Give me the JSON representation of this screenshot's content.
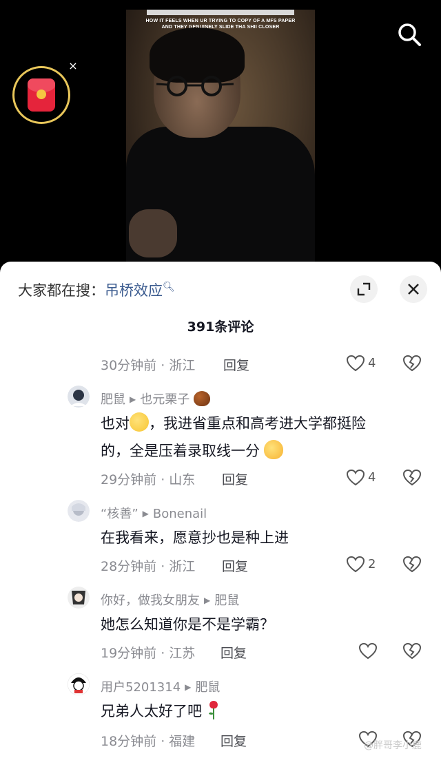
{
  "video": {
    "caption_top": "",
    "caption_line1": "HOW IT FEELS WHEN UR TRYING TO COPY OF A MFS PAPER",
    "caption_line2": "AND THEY GENUINELY SLIDE THA SHII CLOSER"
  },
  "icons": {
    "search": "search-icon",
    "red_packet": "red-envelope-icon",
    "close_small": "close-icon",
    "expand": "expand-icon",
    "close": "close-icon",
    "like": "heart-icon",
    "dislike": "broken-heart-icon"
  },
  "header": {
    "hot_search_prefix": "大家都在搜：",
    "hot_search_term": "吊桥效应",
    "redpacket_close": "×"
  },
  "comment_count": "391条评论",
  "reply_label": "回复",
  "comments": [
    {
      "time_location": "30分钟前 · 浙江",
      "likes": "4"
    },
    {
      "author": "肥鼠",
      "reply_to": "也元栗子",
      "line1_a": "也对",
      "line1_b": "，我进省重点和高考进大学都挺险",
      "line2": "的，全是压着录取线一分",
      "time_location": "29分钟前 · 山东",
      "likes": "4"
    },
    {
      "author": "“核善”",
      "reply_to": "Bonenail",
      "line1": "在我看来，愿意抄也是种上进",
      "time_location": "28分钟前 · 浙江",
      "likes": "2"
    },
    {
      "author": "你好，做我女朋友",
      "reply_to": "肥鼠",
      "line1": "她怎么知道你是不是学霸？",
      "time_location": "19分钟前 · 江苏",
      "likes": ""
    },
    {
      "author": "用户5201314",
      "reply_to": "肥鼠",
      "line1": "兄弟人太好了吧",
      "time_location": "18分钟前 · 福建",
      "likes": ""
    }
  ],
  "watermark": "@胖哥李小鹿",
  "colors": {
    "accent_link": "#3b5b8f",
    "redpacket_ring": "#e8c65a",
    "redpacket_body": "#e5243b"
  }
}
